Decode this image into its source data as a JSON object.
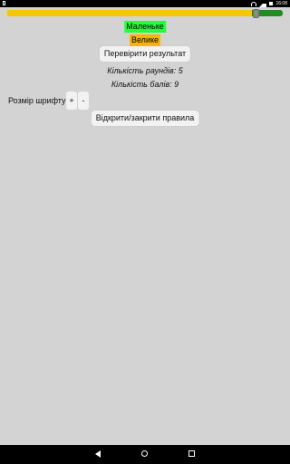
{
  "status_bar": {
    "time": "16:08"
  },
  "slider": {
    "level_percent": 89
  },
  "buttons": {
    "small": "Маленьке",
    "big": "Велике",
    "check": "Перевірити результат",
    "rules": "Відкрити/закрити правила",
    "plus": "+",
    "minus": "-"
  },
  "stats": {
    "rounds": "Кількість раундів: 5",
    "points": "Кількість балів: 9"
  },
  "font_size_label": "Розмір шрифту:",
  "colors": {
    "small_bg": "#22ff3a",
    "big_bg": "#f7b500",
    "slider_yellow": "#f7c600",
    "slider_green": "#218c21"
  },
  "nav": {
    "back_icon": "back-triangle-icon",
    "home_icon": "home-circle-icon",
    "recent_icon": "recent-square-icon"
  }
}
